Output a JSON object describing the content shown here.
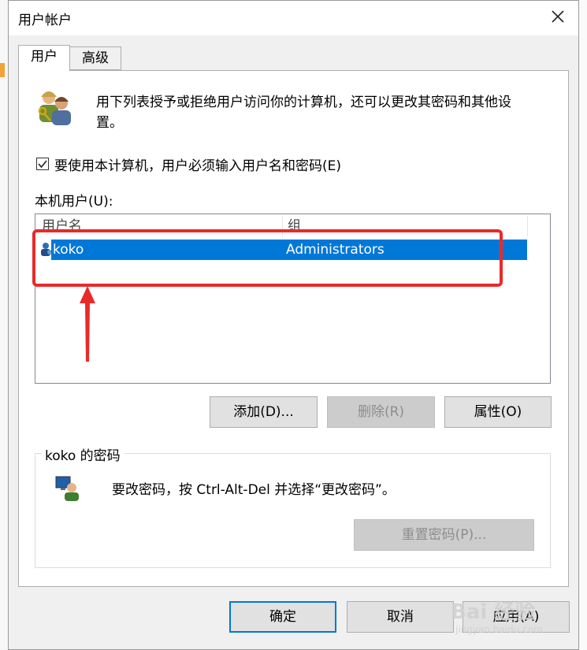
{
  "window": {
    "title": "用户帐户",
    "close_glyph": "✕"
  },
  "tabs": [
    {
      "label": "用户",
      "active": true
    },
    {
      "label": "高级",
      "active": false
    }
  ],
  "intro_text_line1": "用下列表授予或拒绝用户访问你的计算机，还可以更改其密码和其他设",
  "intro_text_line2": "置。",
  "require_login": {
    "label": "要使用本计算机，用户必须输入用户名和密码(E)",
    "checked": true,
    "check_glyph": "✓"
  },
  "local_users": {
    "label": "本机用户(U):",
    "columns": [
      "用户名",
      "组"
    ],
    "rows": [
      {
        "name": "koko",
        "group": "Administrators",
        "selected": true
      }
    ]
  },
  "user_buttons": {
    "add": "添加(D)...",
    "remove": "删除(R)",
    "properties": "属性(O)"
  },
  "password_group": {
    "title": "koko 的密码",
    "description": "要改密码，按 Ctrl-Alt-Del 并选择“更改密码”。",
    "reset_button": "重置密码(P)..."
  },
  "footer_buttons": {
    "ok": "确定",
    "cancel": "取消",
    "apply": "应用(A)"
  },
  "watermark": {
    "brand": "Bai 经验",
    "url": "jingyan.baidu.com"
  },
  "colors": {
    "selection": "#0078d7",
    "annotation_red": "#e82a2a"
  }
}
